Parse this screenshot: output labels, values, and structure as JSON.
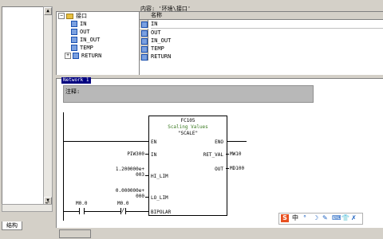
{
  "left": {
    "tab": "结构",
    "scroll_up": "▲",
    "scroll_down": "▼",
    "side_glyph": "乇"
  },
  "content_label": "内容: '环境\\接口'",
  "tree": {
    "root": "接口",
    "items": [
      "IN",
      "OUT",
      "IN_OUT",
      "TEMP",
      "RETURN"
    ],
    "expander": "+"
  },
  "iface": {
    "column": "名称",
    "rows": [
      "IN",
      "OUT",
      "IN_OUT",
      "TEMP",
      "RETURN"
    ]
  },
  "network": {
    "title": "Network 1",
    "comment_label": "注释:",
    "block": {
      "number": "FC105",
      "name": "Scaling Values",
      "symbol": "\"SCALE\"",
      "pin_en": "EN",
      "pin_eno": "ENO",
      "pin_in": "IN",
      "pin_ret": "RET_VAL",
      "pin_out": "OUT",
      "pin_hi": "HI_LIM",
      "pin_lo": "LO_LIM",
      "pin_bipolar": "BIPOLAR"
    },
    "in_value": "PIW300",
    "hi_value_1": "1.200000e+",
    "hi_value_2": "003",
    "lo_value_1": "0.000000e+",
    "lo_value_2": "000",
    "ret_value": "MW10",
    "out_value": "MD100",
    "contact1": "M0.0",
    "contact2": "M0.0",
    "contact2_sym": "/"
  },
  "ime": {
    "logo": "S",
    "lang": "中",
    "items": [
      "°",
      "☽",
      "✎",
      "⌨",
      "👕",
      "✗"
    ]
  }
}
